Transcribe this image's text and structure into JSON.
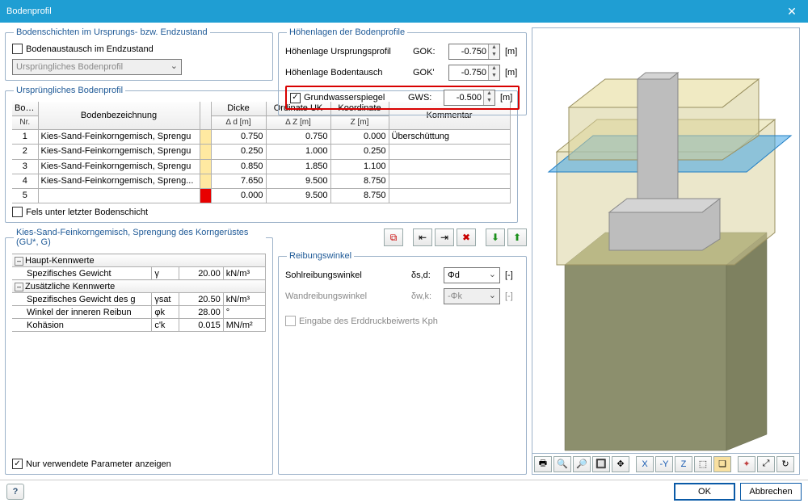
{
  "window": {
    "title": "Bodenprofil",
    "close": "✕"
  },
  "layers_box": {
    "legend": "Bodenschichten im Ursprungs- bzw. Endzustand",
    "ba_checkbox": "Bodenaustausch im Endzustand",
    "ba_checked": false,
    "combo_value": "Ursprüngliches Bodenprofil"
  },
  "heights_box": {
    "legend": "Höhenlagen der Bodenprofile",
    "rows": [
      {
        "label": "Höhenlage Ursprungsprofil",
        "tag": "GOK:",
        "value": "-0.750",
        "unit": "[m]"
      },
      {
        "label": "Höhenlage Bodentausch",
        "tag": "GOK'",
        "value": "-0.750",
        "unit": "[m]"
      }
    ],
    "gws": {
      "label": "Grundwasserspiegel",
      "checked": true,
      "tag": "GWS:",
      "value": "-0.500",
      "unit": "[m]"
    }
  },
  "profile_box": {
    "legend": "Ursprüngliches Bodenprofil",
    "headers": {
      "nr_top": "Boden",
      "nr_bot": "Nr.",
      "name": "Bodenbezeichnung",
      "dicke_top": "Dicke",
      "dicke_bot": "Δ d [m]",
      "ouk_top": "Ordinate UK",
      "ouk_bot": "Δ Z [m]",
      "z_top": "Koordinate",
      "z_bot": "Z [m]",
      "komm": "Kommentar"
    },
    "rows": [
      {
        "nr": "1",
        "name": "Kies-Sand-Feinkorngemisch, Sprengu",
        "dicke": "0.750",
        "ouk": "0.750",
        "z": "0.000",
        "komm": "Überschüttung"
      },
      {
        "nr": "2",
        "name": "Kies-Sand-Feinkorngemisch, Sprengu",
        "dicke": "0.250",
        "ouk": "1.000",
        "z": "0.250",
        "komm": ""
      },
      {
        "nr": "3",
        "name": "Kies-Sand-Feinkorngemisch, Sprengu",
        "dicke": "0.850",
        "ouk": "1.850",
        "z": "1.100",
        "komm": ""
      },
      {
        "nr": "4",
        "name": "Kies-Sand-Feinkorngemisch, Spreng...",
        "dicke": "7.650",
        "ouk": "9.500",
        "z": "8.750",
        "komm": ""
      },
      {
        "nr": "5",
        "name": "",
        "dicke": "0.000",
        "ouk": "9.500",
        "z": "8.750",
        "komm": ""
      }
    ],
    "fels_checkbox": "Fels unter letzter Bodenschicht",
    "icons": [
      "layers",
      "insert-before",
      "insert-after",
      "delete",
      "move-up",
      "move-down"
    ]
  },
  "params_box": {
    "legend": "Kies-Sand-Feinkorngemisch, Sprengung des Korngerüstes (GU*, G)",
    "group1": "Haupt-Kennwerte",
    "group2": "Zusätzliche Kennwerte",
    "rows": [
      {
        "label": "Spezifisches Gewicht",
        "sym": "γ",
        "val": "20.00",
        "unit": "kN/m³"
      },
      {
        "label": "Spezifisches Gewicht des g",
        "sym": "γsat",
        "val": "20.50",
        "unit": "kN/m³"
      },
      {
        "label": "Winkel der inneren Reibun",
        "sym": "φk",
        "val": "28.00",
        "unit": "°"
      },
      {
        "label": "Kohäsion",
        "sym": "c'k",
        "val": "0.015",
        "unit": "MN/m²"
      }
    ],
    "only_used_cb": "Nur verwendete Parameter anzeigen"
  },
  "friction_box": {
    "legend": "Reibungswinkel",
    "rows": [
      {
        "label": "Sohlreibungswinkel",
        "sym": "δs,d:",
        "combo": "Φd",
        "unit": "[-]",
        "enabled": true
      },
      {
        "label": "Wandreibungswinkel",
        "sym": "δw,k:",
        "combo": "-Φk",
        "unit": "[-]",
        "enabled": false
      }
    ],
    "kph_cb": "Eingabe des Erddruckbeiwerts Kph"
  },
  "preview_toolbar": {
    "names": [
      "print-icon",
      "zoom-fit-icon",
      "zoom-in-icon",
      "zoom-window-icon",
      "pan-icon",
      "axis-x-icon",
      "axis-y-icon",
      "axis-z-icon",
      "iso-icon",
      "view-icon",
      "origin-icon",
      "expand-icon",
      "rotate-icon"
    ],
    "glyphs": [
      "🖶",
      "🔍",
      "🔎",
      "🔲",
      "✥",
      "X",
      "-Y",
      "Z",
      "⬚",
      "❏",
      "✦",
      "⤢",
      "↻"
    ]
  },
  "footer": {
    "ok": "OK",
    "cancel": "Abbrechen",
    "help": "?"
  }
}
